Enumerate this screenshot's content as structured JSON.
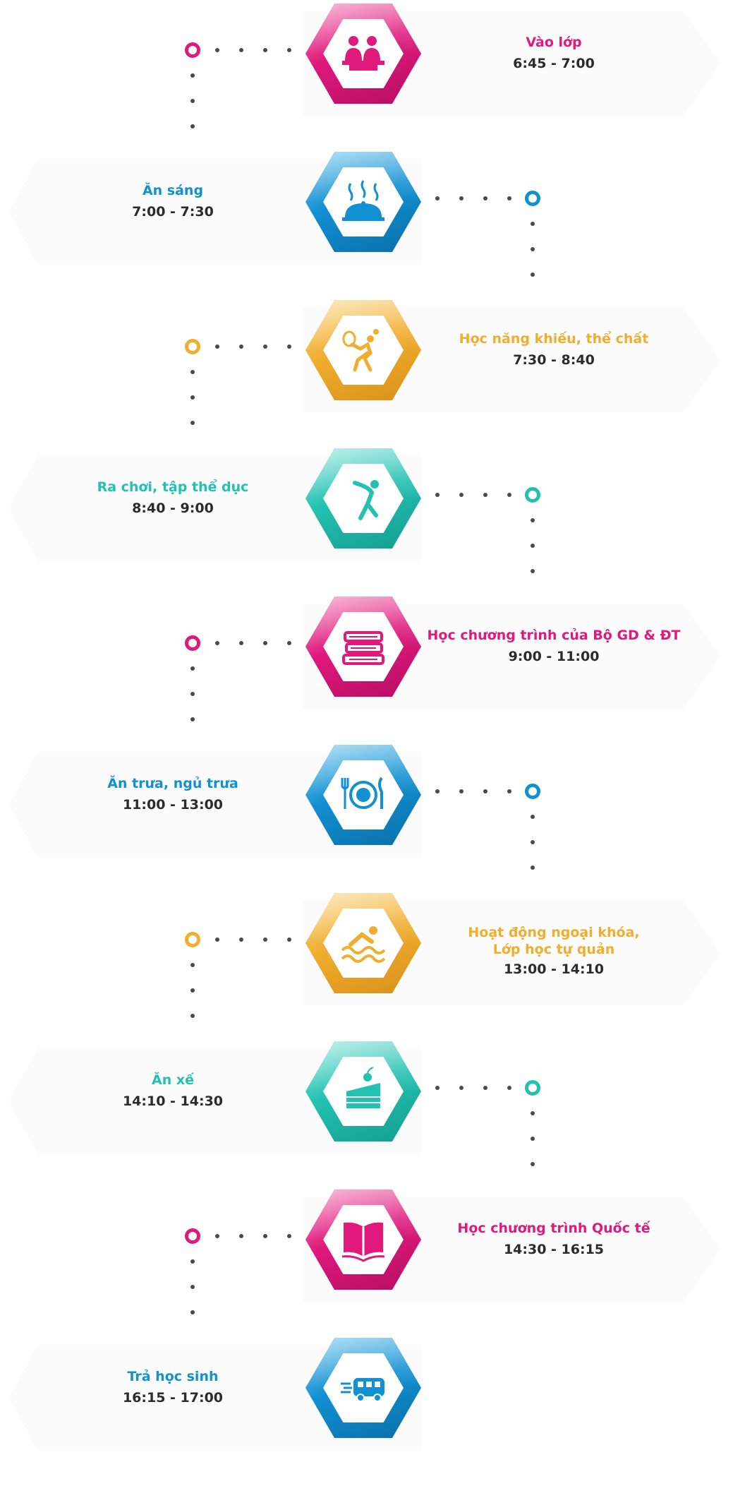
{
  "colors": {
    "pink": "#e0197d",
    "blue": "#1190d2",
    "orange": "#f0ae2e",
    "teal": "#23c1b1"
  },
  "items": [
    {
      "title": "Vào lớp",
      "time": "6:45 - 7:00",
      "color": "pink",
      "icon": "students-at-desk-icon"
    },
    {
      "title": "Ăn sáng",
      "time": "7:00 - 7:30",
      "color": "blue",
      "icon": "food-cloche-icon"
    },
    {
      "title": "Học năng khiếu, thể chất",
      "time": "7:30 - 8:40",
      "color": "orange",
      "icon": "tennis-player-icon"
    },
    {
      "title": "Ra chơi, tập thể dục",
      "time": "8:40 - 9:00",
      "color": "teal",
      "icon": "stretching-person-icon"
    },
    {
      "title": "Học chương trình của Bộ GD & ĐT",
      "time": "9:00 - 11:00",
      "color": "pink",
      "icon": "book-stack-icon"
    },
    {
      "title": "Ăn trưa, ngủ trưa",
      "time": "11:00 - 13:00",
      "color": "blue",
      "icon": "plate-cutlery-icon"
    },
    {
      "title": "Hoạt động ngoại khóa,\nLớp học tự quản",
      "time": "13:00 - 14:10",
      "color": "orange",
      "icon": "swimmer-icon"
    },
    {
      "title": "Ăn xế",
      "time": "14:10 - 14:30",
      "color": "teal",
      "icon": "cake-slice-icon"
    },
    {
      "title": "Học chương trình Quốc tế",
      "time": "14:30 - 16:15",
      "color": "pink",
      "icon": "open-book-icon"
    },
    {
      "title": "Trả học sinh",
      "time": "16:15 - 17:00",
      "color": "blue",
      "icon": "school-bus-icon"
    }
  ]
}
